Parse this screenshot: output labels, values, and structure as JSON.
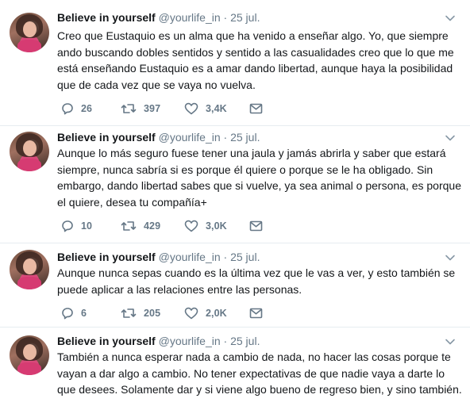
{
  "tweets": [
    {
      "name": "Believe in yourself",
      "handle": "@yourlife_in",
      "separator": "·",
      "date": "25 jul.",
      "lines": [
        "Creo que Eustaquio es un alma que ha venido a enseñar algo. Yo, que siempre",
        "ando buscando dobles sentidos y sentido a las casualidades creo que lo que me",
        "está enseñando Eustaquio es a amar dando libertad, aunque haya la posibilidad",
        "que de cada vez que se vaya no vuelva."
      ],
      "replies": "26",
      "retweets": "397",
      "likes": "3,4K"
    },
    {
      "name": "Believe in yourself",
      "handle": "@yourlife_in",
      "separator": "·",
      "date": "25 jul.",
      "lines": [
        "Aunque lo más seguro fuese tener una jaula y jamás abrirla y saber que estará",
        "siempre, nunca sabría si es porque él quiere o porque se le ha obligado. Sin",
        "embargo, dando libertad sabes que si vuelve, ya sea animal o persona, es porque",
        "el quiere, desea tu compañía+"
      ],
      "replies": "10",
      "retweets": "429",
      "likes": "3,0K"
    },
    {
      "name": "Believe in yourself",
      "handle": "@yourlife_in",
      "separator": "·",
      "date": "25 jul.",
      "lines": [
        "Aunque nunca sepas cuando es la última vez que le vas a ver, y esto también se",
        "puede aplicar a las relaciones entre las personas."
      ],
      "replies": "6",
      "retweets": "205",
      "likes": "2,0K"
    },
    {
      "name": "Believe in yourself",
      "handle": "@yourlife_in",
      "separator": "·",
      "date": "25 jul.",
      "lines": [
        "También a nunca esperar nada a cambio de nada, no hacer las cosas porque te",
        "vayan a dar algo a cambio. No tener expectativas de que nadie vaya a darte lo",
        "que desees. Solamente dar y si viene algo bueno de regreso bien, y sino también."
      ]
    }
  ],
  "icons": {
    "reply": "reply-icon",
    "retweet": "retweet-icon",
    "like": "heart-icon",
    "dm": "envelope-icon",
    "more": "chevron-down-icon"
  },
  "colors": {
    "text": "#14171a",
    "muted": "#657786",
    "divider": "#e6ecf0"
  }
}
